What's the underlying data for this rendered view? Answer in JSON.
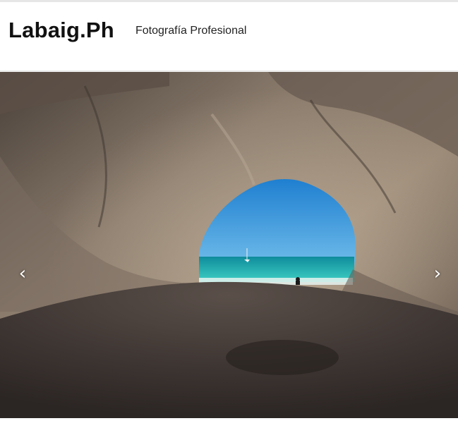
{
  "site": {
    "title": "Labaig.Ph",
    "tagline": "Fotografía Profesional"
  },
  "slider": {
    "image": "sea-cave-beach-photo",
    "prev_icon": "chevron-left-icon",
    "next_icon": "chevron-right-icon",
    "prev_glyph": "‹",
    "next_glyph": "›"
  },
  "colors": {
    "sky": "#2f8fd6",
    "sea": "#1fb5b0",
    "rock": "#6b5d52",
    "sand": "#3b3431"
  }
}
